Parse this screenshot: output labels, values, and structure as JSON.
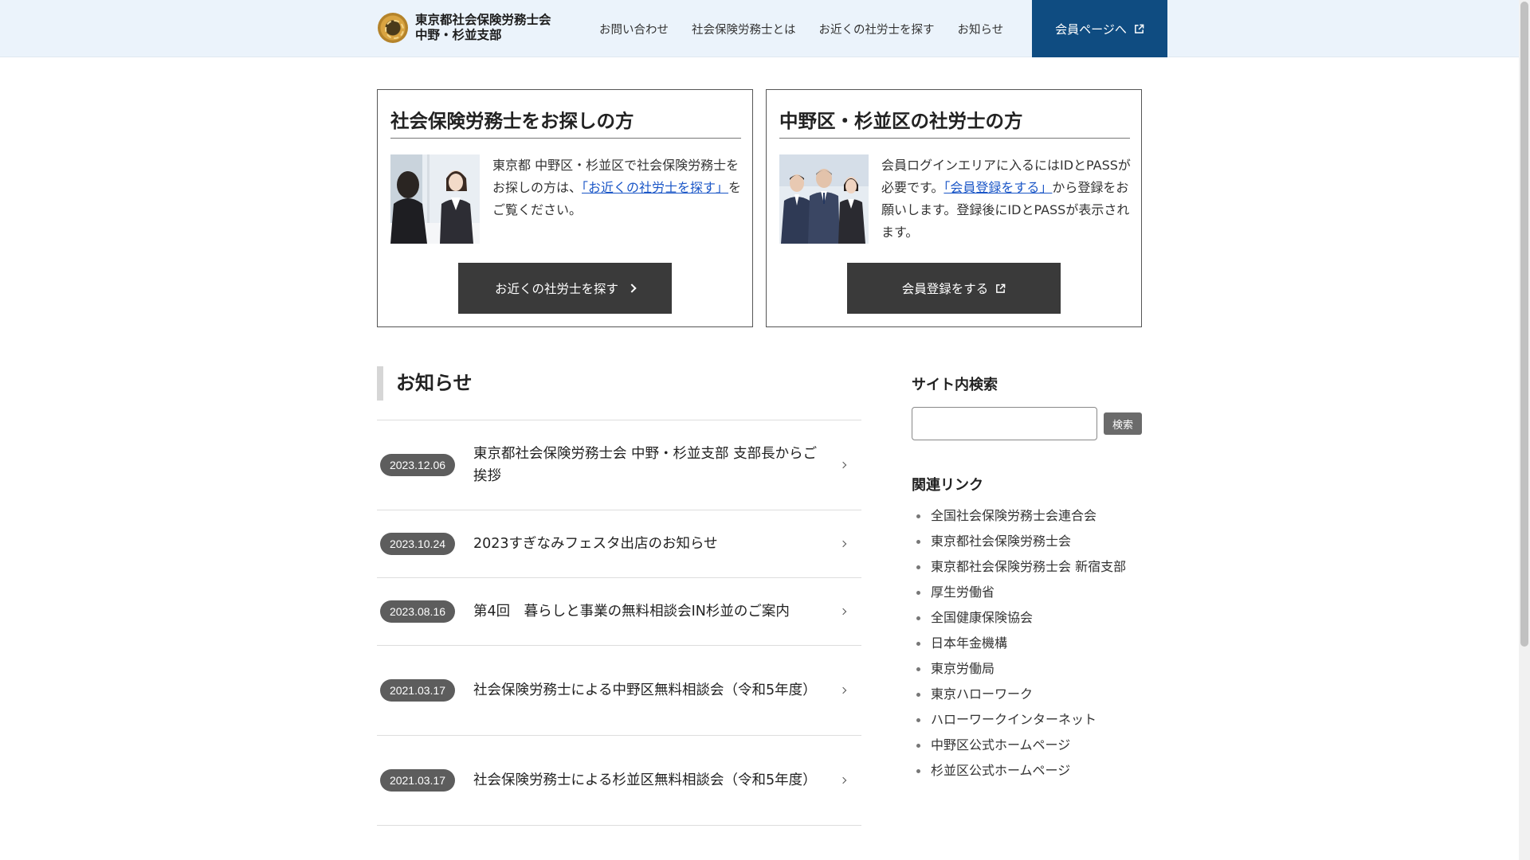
{
  "header": {
    "org_line1": "東京都社会保険労務士会",
    "org_line2": "中野・杉並支部",
    "nav": [
      "お問い合わせ",
      "社会保険労務士とは",
      "お近くの社労士を探す",
      "お知らせ"
    ],
    "member_button": "会員ページへ",
    "member_bg": "#0f4c81"
  },
  "cards": {
    "left": {
      "title": "社会保険労務士をお探しの方",
      "text_before": "東京都 中野区・杉並区で社会保険労務士をお探しの方は、",
      "link": "「お近くの社労士を探す」",
      "text_after": "をご覧ください。",
      "button": "お近くの社労士を探す"
    },
    "right": {
      "title": "中野区・杉並区の社労士の方",
      "text_before": "会員ログインエリアに入るにはIDとPASSが必要です。",
      "link": "「会員登録をする」",
      "text_after": "から登録をお願いします。登録後にIDとPASSが表示されます。",
      "button": "会員登録をする"
    }
  },
  "news": {
    "heading": "お知らせ",
    "items": [
      {
        "date": "2023.12.06",
        "title": "東京都社会保険労務士会 中野・杉並支部 支部長からご挨拶"
      },
      {
        "date": "2023.10.24",
        "title": "2023すぎなみフェスタ出店のお知らせ"
      },
      {
        "date": "2023.08.16",
        "title": "第4回　暮らしと事業の無料相談会IN杉並のご案内"
      },
      {
        "date": "2021.03.17",
        "title": "社会保険労務士による中野区無料相談会（令和5年度）"
      },
      {
        "date": "2021.03.17",
        "title": "社会保険労務士による杉並区無料相談会（令和5年度）"
      }
    ]
  },
  "sidebar": {
    "search_heading": "サイト内検索",
    "search_value": "",
    "search_button": "検索",
    "links_heading": "関連リンク",
    "links": [
      "全国社会保険労務士会連合会",
      "東京都社会保険労務士会",
      "東京都社会保険労務士会 新宿支部",
      "厚生労働省",
      "全国健康保険協会",
      "日本年金機構",
      "東京労働局",
      "東京ハローワーク",
      "ハローワークインターネット",
      "中野区公式ホームページ",
      "杉並区公式ホームページ"
    ]
  }
}
